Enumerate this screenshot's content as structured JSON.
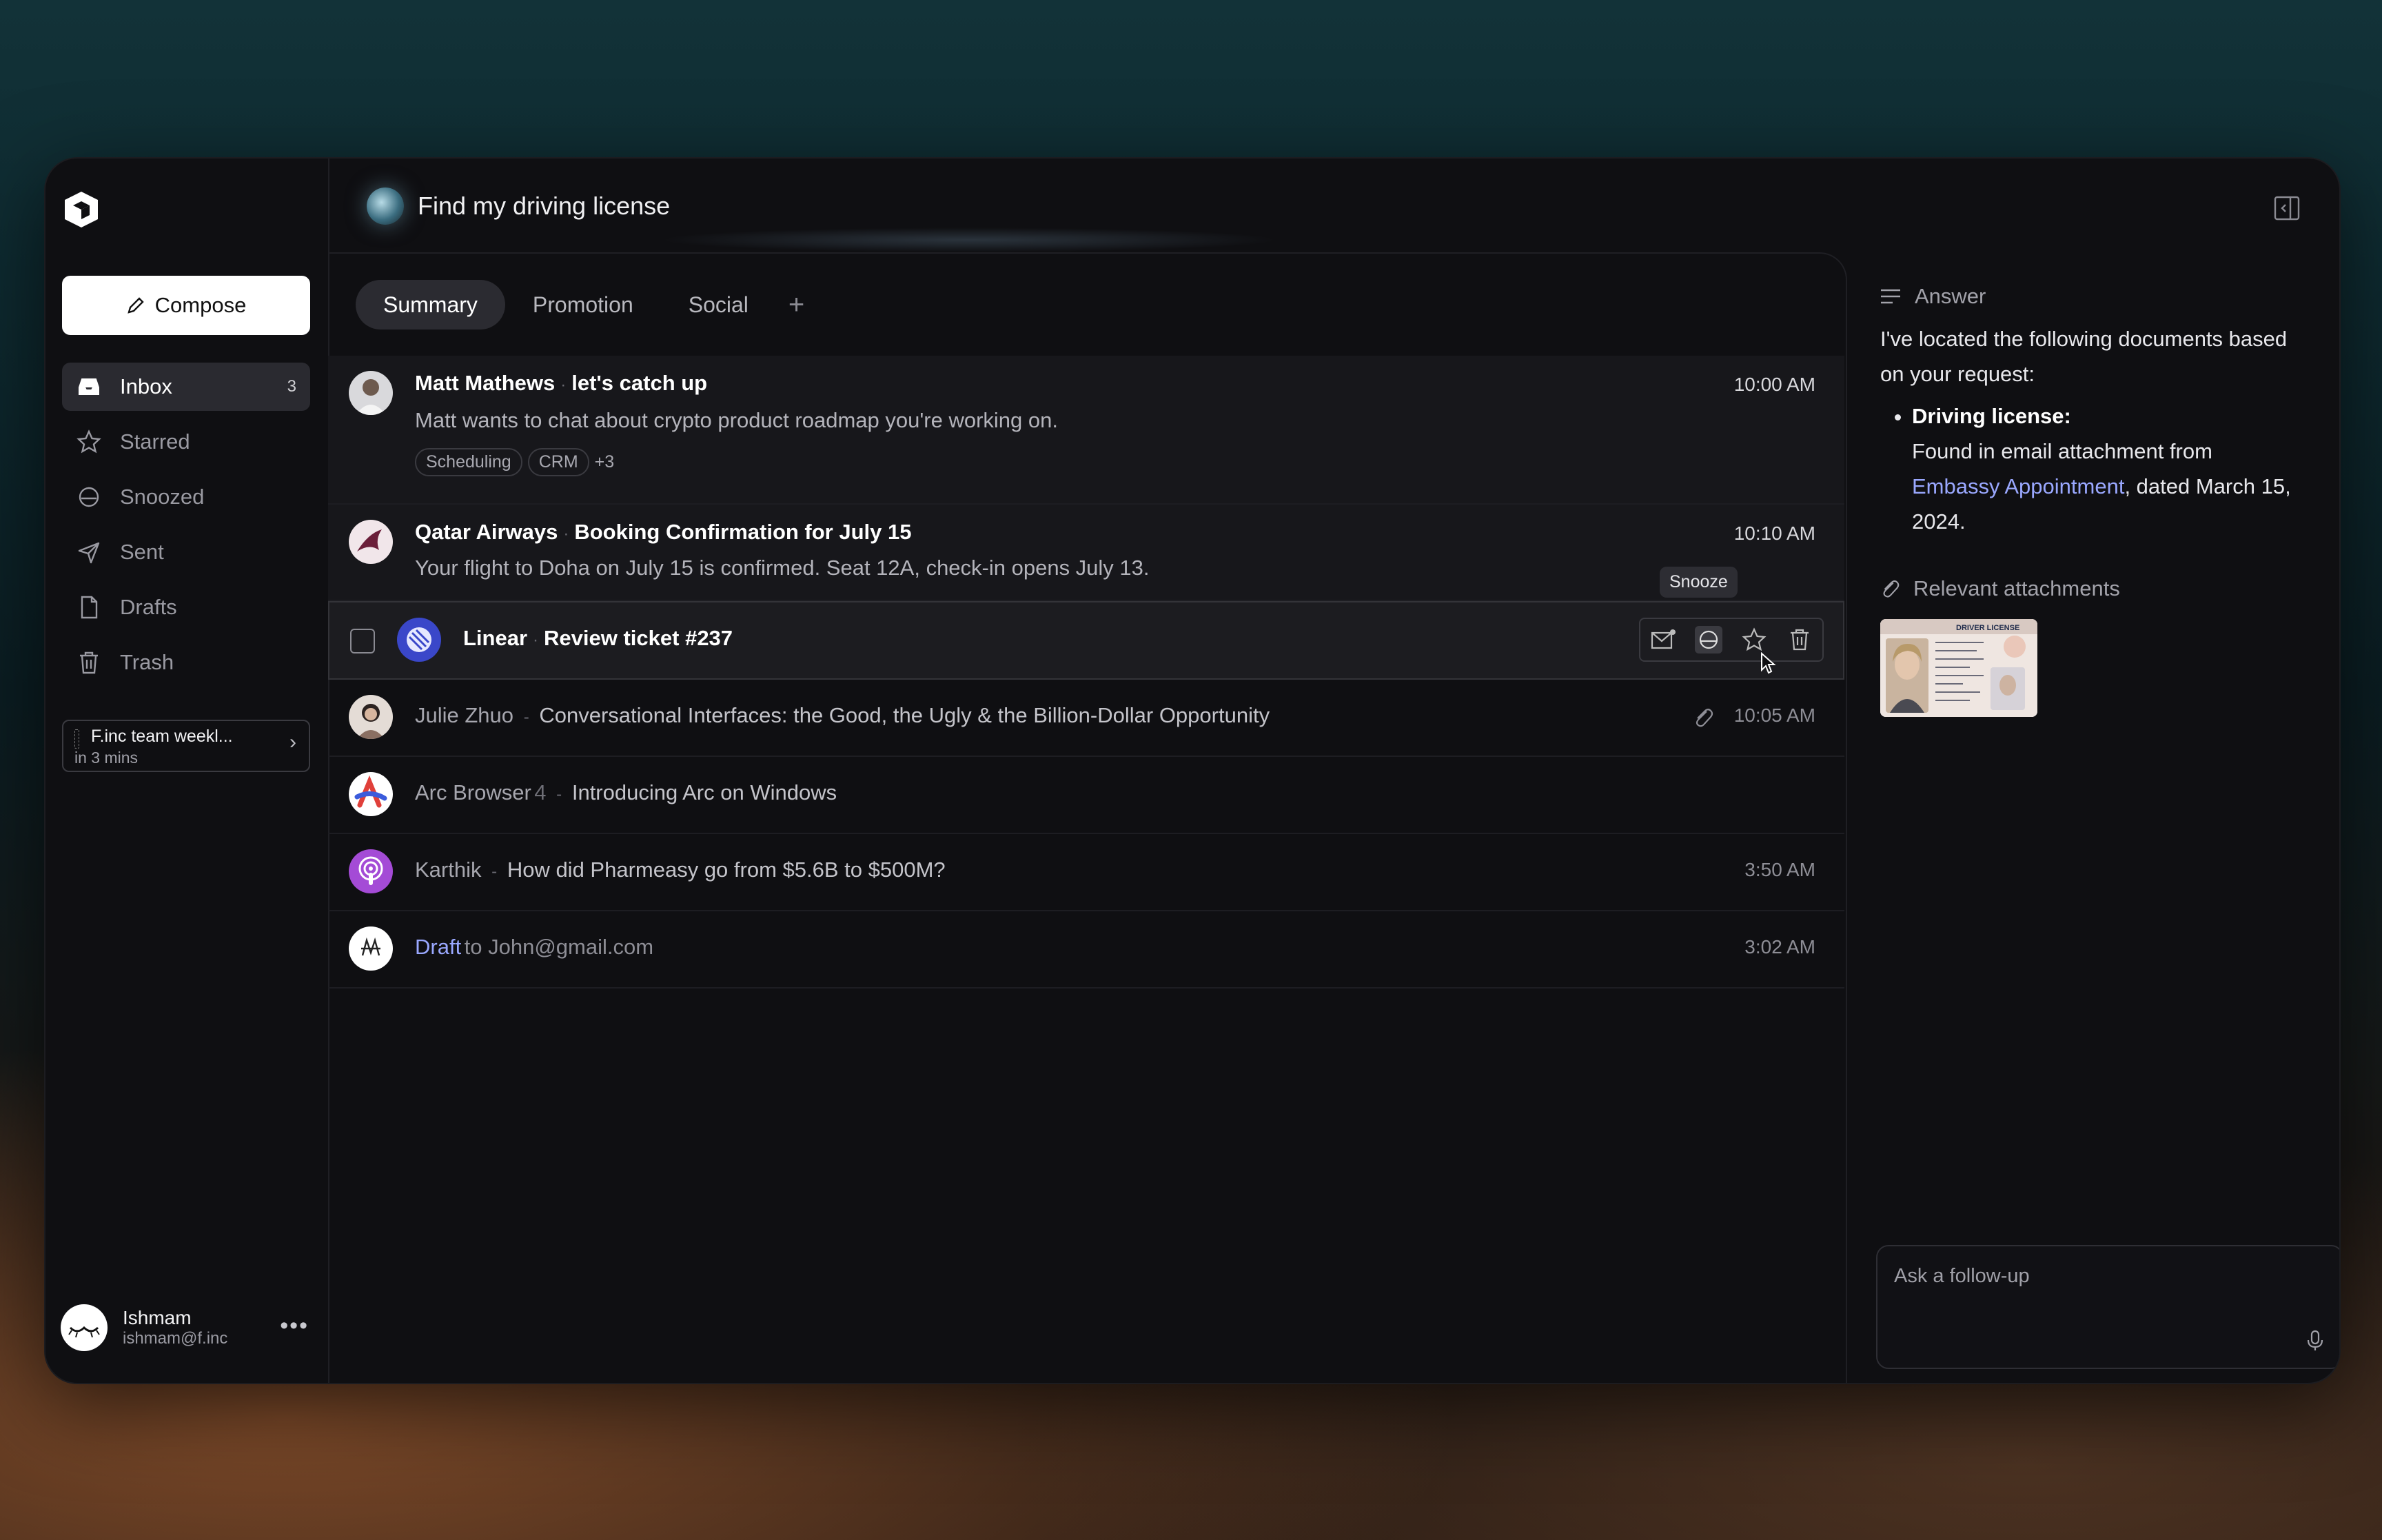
{
  "search": {
    "query": "Find my driving license"
  },
  "sidebar": {
    "compose_label": "Compose",
    "items": [
      {
        "label": "Inbox",
        "count": "3",
        "icon": "inbox-icon"
      },
      {
        "label": "Starred",
        "icon": "star-icon"
      },
      {
        "label": "Snoozed",
        "icon": "snooze-icon"
      },
      {
        "label": "Sent",
        "icon": "send-icon"
      },
      {
        "label": "Drafts",
        "icon": "draft-icon"
      },
      {
        "label": "Trash",
        "icon": "trash-icon"
      }
    ],
    "event": {
      "title": "F.inc team weekl...",
      "time": "in 3 mins"
    },
    "user": {
      "name": "Ishmam",
      "email": "ishmam@f.inc"
    }
  },
  "tabs": [
    "Summary",
    "Promotion",
    "Social"
  ],
  "emails": [
    {
      "sender": "Matt Mathews",
      "subject": "let's catch up",
      "preview": "Matt wants to chat about crypto product roadmap you're working on.",
      "time": "10:00 AM",
      "chips": [
        "Scheduling",
        "CRM"
      ],
      "more_chips": "+3"
    },
    {
      "sender": "Qatar Airways",
      "subject": "Booking Confirmation for July 15",
      "preview": "Your flight to Doha on July 15 is confirmed. Seat 12A, check-in opens July 13.",
      "time": "10:10 AM"
    },
    {
      "sender": "Linear",
      "subject": "Review ticket #237",
      "tooltip": "Snooze"
    },
    {
      "sender": "Julie Zhuo",
      "subject": "Conversational Interfaces: the Good, the Ugly & the Billion-Dollar Opportunity",
      "time": "10:05 AM"
    },
    {
      "sender": "Arc Browser",
      "count": "4",
      "subject": "Introducing Arc on Windows"
    },
    {
      "sender": "Karthik",
      "subject": "How did Pharmeasy go from $5.6B to $500M?",
      "time": "3:50 AM"
    },
    {
      "sender": "Draft",
      "subject": "to John@gmail.com",
      "time": "3:02 AM"
    }
  ],
  "answer": {
    "heading": "Answer",
    "intro": "I've located the following documents based on your request:",
    "bullet_title": "Driving license:",
    "bullet_text_1": "Found in email attachment from",
    "bullet_link": "Embassy Appointment",
    "bullet_text_2": ", dated March 15, 2024.",
    "attachments_heading": "Relevant attachments",
    "attachment_label": "DRIVER LICENSE",
    "followup_placeholder": "Ask a follow-up"
  },
  "colors": {
    "accent_link": "#9aa8ff",
    "background": "#0f0f12"
  }
}
